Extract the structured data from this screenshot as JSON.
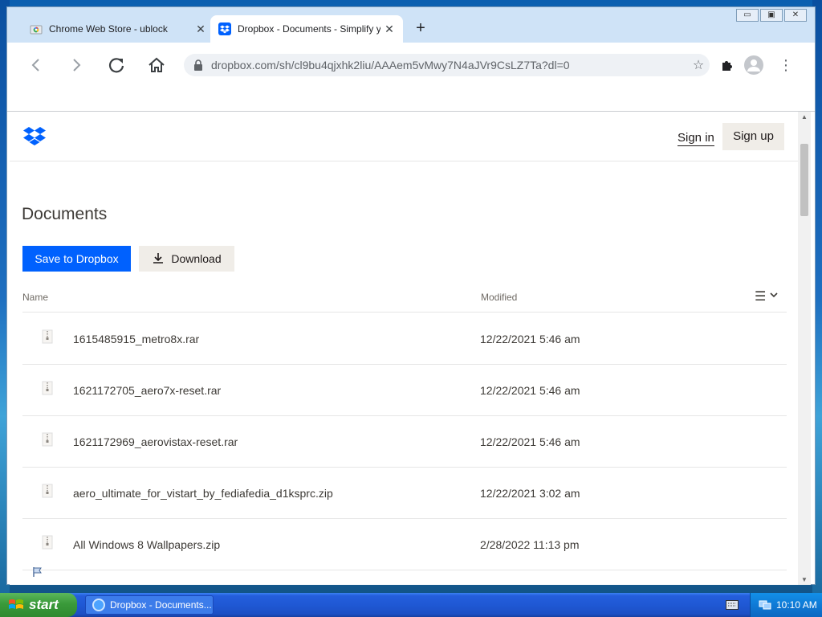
{
  "browser": {
    "tabs": [
      {
        "title": "Chrome Web Store - ublock",
        "close": "✕"
      },
      {
        "title": "Dropbox - Documents - Simplify your",
        "close": "✕"
      }
    ],
    "new_tab": "+",
    "window_controls": [
      "▭",
      "▣",
      "✕"
    ],
    "url": "dropbox.com/sh/cl9bu4qjxhk2liu/AAAem5vMwy7N4aJVr9CsLZ7Ta?dl=0",
    "icons": {
      "back": "arrow-left-icon",
      "forward": "arrow-right-icon",
      "reload": "reload-icon",
      "home": "home-icon",
      "lock": "lock-icon",
      "star": "star-icon",
      "extensions": "puzzle-icon",
      "profile": "profile-icon",
      "menu": "kebab-menu-icon"
    }
  },
  "dropbox": {
    "header": {
      "sign_in": "Sign in",
      "sign_up": "Sign up"
    },
    "title": "Documents",
    "buttons": {
      "save": "Save to Dropbox",
      "download": "Download"
    },
    "columns": {
      "name": "Name",
      "modified": "Modified"
    },
    "files": [
      {
        "name": "1615485915_metro8x.rar",
        "modified": "12/22/2021 5:46 am"
      },
      {
        "name": "1621172705_aero7x-reset.rar",
        "modified": "12/22/2021 5:46 am"
      },
      {
        "name": "1621172969_aerovistax-reset.rar",
        "modified": "12/22/2021 5:46 am"
      },
      {
        "name": "aero_ultimate_for_vistart_by_fediafedia_d1ksprc.zip",
        "modified": "12/22/2021 3:02 am"
      },
      {
        "name": "All Windows 8 Wallpapers.zip",
        "modified": "2/28/2022 11:13 pm"
      }
    ],
    "colors": {
      "primary": "#0061fe",
      "secondary_bg": "#f0ede8",
      "text": "#3d3a36"
    }
  },
  "taskbar": {
    "start": "start",
    "task": "Dropbox - Documents...",
    "clock": "10:10 AM"
  }
}
